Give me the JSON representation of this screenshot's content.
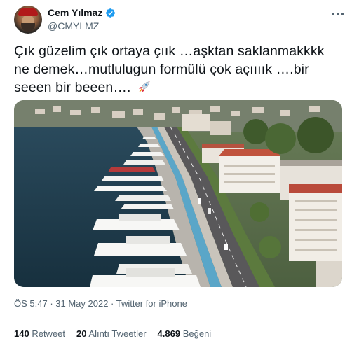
{
  "user": {
    "display_name": "Cem Yılmaz",
    "handle": "@CMYLMZ",
    "verified_color": "#1d9bf0"
  },
  "tweet": {
    "text": "Çık güzelim çık ortaya çıık …aşktan saklanmakkkk ne demek…mutlulugun formülü çok açıııık ….bir seeen bir beeen….",
    "emoji": "rocket-icon",
    "image_alt": "Aerial photo of yachts moored along a seaside promenade",
    "time": "ÖS 5:47",
    "date": "31 May 2022",
    "separator": " · ",
    "source": "Twitter for iPhone"
  },
  "stats": {
    "retweets": {
      "count": "140",
      "label": "Retweet"
    },
    "quotes": {
      "count": "20",
      "label": "Alıntı Tweetler"
    },
    "likes": {
      "count": "4.869",
      "label": "Beğeni"
    }
  },
  "colors": {
    "text": "#0f1419",
    "secondary": "#536471",
    "divider": "#eff3f4"
  }
}
